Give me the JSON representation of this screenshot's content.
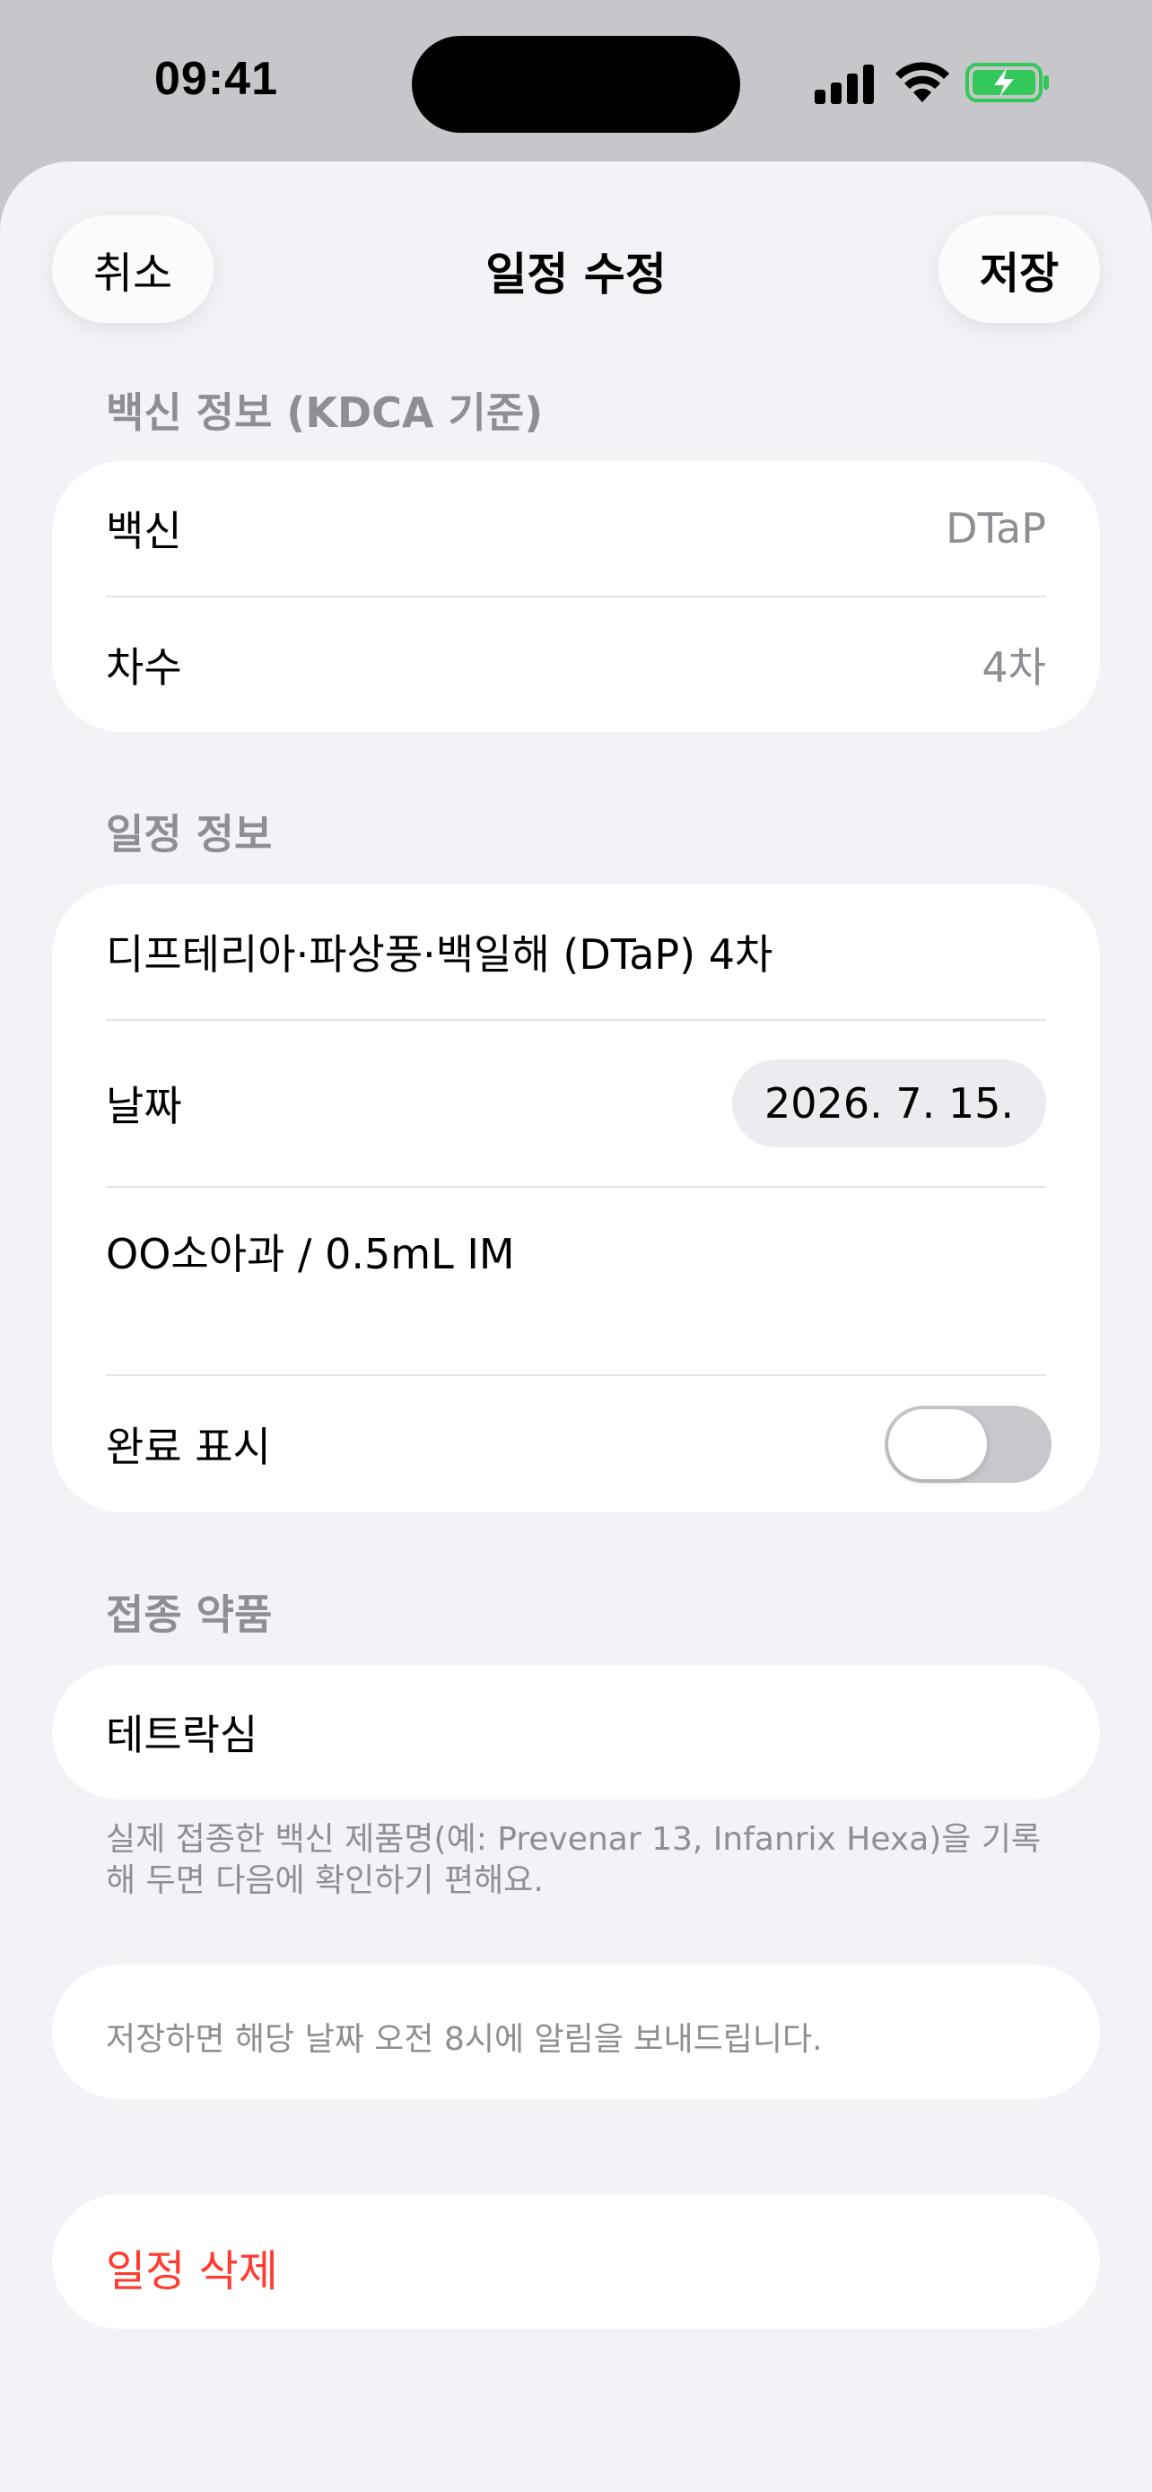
{
  "status_bar": {
    "time": "09:41",
    "icons": [
      "cellular-signal-icon",
      "wifi-icon",
      "battery-charging-icon"
    ],
    "battery_color": "#34c759"
  },
  "nav": {
    "cancel_label": "취소",
    "title": "일정 수정",
    "save_label": "저장"
  },
  "vaccine_info": {
    "header": "백신 정보 (KDCA 기준)",
    "rows": [
      {
        "label": "백신",
        "value": "DTaP"
      },
      {
        "label": "차수",
        "value": "4차"
      }
    ]
  },
  "schedule_info": {
    "header": "일정 정보",
    "title_value": "디프테리아·파상풍·백일해 (DTaP) 4차",
    "date_label": "날짜",
    "date_value": "2026. 7. 15.",
    "memo_value": "OO소아과 / 0.5mL IM",
    "complete_label": "완료 표시",
    "complete_toggle": false
  },
  "product": {
    "header": "접종 약품",
    "value": "테트락심",
    "footnote": "실제 접종한 백신 제품명(예: Prevenar 13, Infanrix Hexa)을 기록해 두면 다음에 확인하기 편해요."
  },
  "notice": {
    "text": "저장하면 해당 날짜 오전 8시에 알림을 보내드립니다."
  },
  "delete": {
    "label": "일정 삭제",
    "color": "#ff3b30"
  }
}
